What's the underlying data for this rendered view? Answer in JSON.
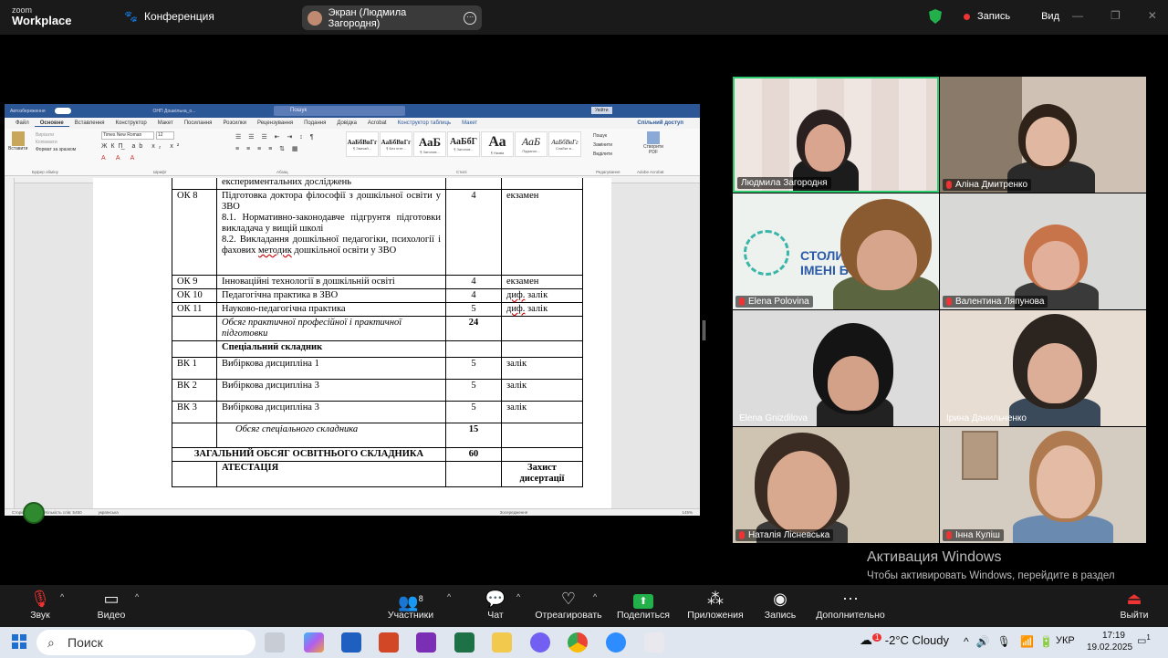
{
  "topbar": {
    "logo_line1": "zoom",
    "logo_line2": "Workplace",
    "conference": "Конференция",
    "screen_share": "Экран (Людмила Загородня)",
    "record": "Запись",
    "view": "Вид"
  },
  "word": {
    "autosave": "Автозбереження",
    "filename": "ОНП Дошкільна_о...",
    "search": "Пошук",
    "account": "Увійти",
    "tabs": [
      "Файл",
      "Основне",
      "Вставлення",
      "Конструктор",
      "Макет",
      "Посилання",
      "Розсилки",
      "Рецензування",
      "Подання",
      "Довідка",
      "Acrobat",
      "Конструктор таблиць",
      "Макет"
    ],
    "share": "Спільний доступ",
    "clipboard": {
      "paste": "Вставити",
      "cut": "Вирізати",
      "copy": "Копіювати",
      "format": "Формат за зразком",
      "label": "Буфер обміну"
    },
    "font": {
      "name": "Times New Roman",
      "size": "12",
      "label": "Шрифт"
    },
    "paragraph_label": "Абзац",
    "styles_label": "Стилі",
    "styles": [
      {
        "sample": "АаБбВвГг",
        "name": "¶ Звичай..."
      },
      {
        "sample": "АаБбВвГг",
        "name": "¶ Без інте..."
      },
      {
        "sample": "АаБ",
        "name": "¶ Заголов..."
      },
      {
        "sample": "АаБбГ",
        "name": "¶ Заголов..."
      },
      {
        "sample": "Аа",
        "name": "¶ Назва"
      },
      {
        "sample": "АаБ",
        "name": "Підзагол..."
      },
      {
        "sample": "АаБбВвГг",
        "name": "Слабке в..."
      }
    ],
    "editing": {
      "find": "Пошук",
      "replace": "Замінити",
      "select": "Виділити",
      "label": "Редагування"
    },
    "acrobat": {
      "create": "Створити PDF",
      "label": "Adobe Acrobat"
    },
    "status": {
      "page": "Сторінка",
      "words": "Кількість слів: 5450",
      "lang": "українська",
      "focus": "Зосередження",
      "zoom": "145%"
    },
    "table": [
      {
        "code": "",
        "name": "експериментальних досліджень",
        "credits": "",
        "form": ""
      },
      {
        "code": "ОК 8",
        "name": "Підготовка доктора філософії з дошкільної освіти у ЗВО",
        "sub1": "8.1. Нормативно-законодавче підгрунтя підготовки викладача у вищій школі",
        "sub2": "8.2. Викладання дошкільної педагогіки, психології і фахових",
        "sub2b": "методик",
        "sub2c": "дошкільної освіти у ЗВО",
        "credits": "4",
        "form": "екзамен"
      },
      {
        "code": "ОК 9",
        "name": "Інноваційні технології в дошкільній освіті",
        "credits": "4",
        "form": "екзамен"
      },
      {
        "code": "ОК 10",
        "name": "Педагогічна практика в ЗВО",
        "credits": "4",
        "form_a": "диф.",
        "form_b": " залік"
      },
      {
        "code": "ОК 11",
        "name": "Науково-педагогічна практика",
        "credits": "5",
        "form_a": "диф.",
        "form_b": " залік"
      },
      {
        "code": "",
        "name": "Обсяг практичної професійної і практичної підготовки",
        "credits": "24",
        "form": ""
      },
      {
        "section": "Спеціальний складник"
      },
      {
        "code": "ВК 1",
        "name": "Вибіркова дисципліна 1",
        "credits": "5",
        "form": "залік"
      },
      {
        "code": "ВК 2",
        "name": "Вибіркова дисципліна 3",
        "credits": "5",
        "form": "залік"
      },
      {
        "code": "ВК 3",
        "name": "Вибіркова дисципліна 3",
        "credits": "5",
        "form": "залік"
      },
      {
        "code": "",
        "name": "Обсяг спеціального складника",
        "credits": "15",
        "form": ""
      },
      {
        "total": "ЗАГАЛЬНИЙ ОБСЯГ ОСВІТНЬОГО СКЛАДНИКА",
        "credits": "60"
      },
      {
        "attest": "АТЕСТАЦІЯ",
        "form": "Захист дисертації"
      }
    ]
  },
  "participants": [
    "Людмила Загородня",
    "Аліна Дмитренко",
    "Elena Polovina",
    "Валентина Ляпунова",
    "Elena Gnizdilova",
    "Ірина  Данильченко",
    "Наталія Лісневська",
    "Інна Куліш"
  ],
  "tile_brand": {
    "line1": "СТОЛИЧ",
    "line2": "ІМЕНІ БО"
  },
  "activation": {
    "title": "Активация Windows",
    "text": "Чтобы активировать Windows, перейдите в раздел \"Параметры\"."
  },
  "toolbar": {
    "mute": "Звук",
    "video": "Видео",
    "participants": "Участники",
    "participants_count": "8",
    "chat": "Чат",
    "react": "Отреагировать",
    "share": "Поделиться",
    "apps": "Приложения",
    "record": "Запись",
    "more": "Дополнительно",
    "leave": "Выйти"
  },
  "taskbar": {
    "search": "Поиск",
    "weather": "-2°C  Cloudy",
    "weather_badge": "1",
    "lang": "УКР",
    "time": "17:19",
    "date": "19.02.2025",
    "notif": "1"
  },
  "colors": {
    "active_speaker": "#2ecc71",
    "record": "#e33333",
    "word_blue": "#2b5797"
  }
}
